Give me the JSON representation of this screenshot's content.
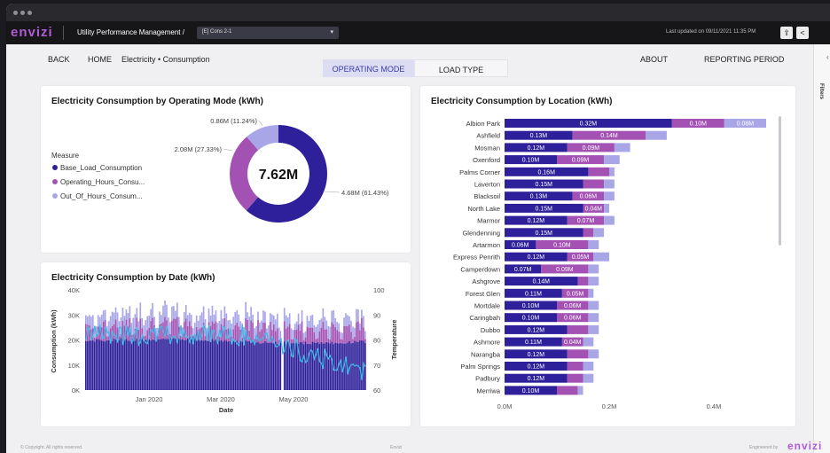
{
  "app": {
    "logo": "envizi",
    "title": "Utility Performance Management  /",
    "dropdown_value": "[E] Cons 2-1",
    "last_updated": "Last updated on 09/11/2021 11:35 PM",
    "footer_left": "© Copyright. All rights reserved.",
    "footer_center": "Envizi",
    "footer_right_label": "Engineered by",
    "footer_right_logo": "envizi"
  },
  "nav": {
    "back": "BACK",
    "home": "HOME",
    "breadcrumb": "Electricity • Consumption",
    "about": "ABOUT",
    "reporting_period": "REPORTING PERIOD",
    "filters": "Filters"
  },
  "tabs": [
    {
      "label": "OPERATING MODE",
      "active": true
    },
    {
      "label": "LOAD TYPE",
      "active": false
    }
  ],
  "colors": {
    "base": "#2e1f9a",
    "operating": "#a352b4",
    "out_of_hours": "#a9a6e8",
    "temperature": "#3fb8e6",
    "accent": "#b05bd6"
  },
  "donut": {
    "title": "Electricity Consumption by Operating Mode (kWh)",
    "center_value": "7.62M",
    "legend_title": "Measure",
    "segments": [
      {
        "name": "Base_Load_Consumption",
        "legend": "Base_Load_Consumption",
        "value": 4.68,
        "label": "4.68M (61.43%)",
        "color": "#2e1f9a"
      },
      {
        "name": "Operating_Hours_Consumption",
        "legend": "Operating_Hours_Consu...",
        "value": 2.08,
        "label": "2.08M (27.33%)",
        "color": "#a352b4"
      },
      {
        "name": "Out_Of_Hours_Consumption",
        "legend": "Out_Of_Hours_Consum...",
        "value": 0.86,
        "label": "0.86M (11.24%)",
        "color": "#a9a6e8"
      }
    ]
  },
  "chart_data": [
    {
      "type": "bar",
      "orientation": "horizontal",
      "stacked": true,
      "title": "Electricity Consumption by Location (kWh)",
      "categories": [
        "Albion Park",
        "Ashfield",
        "Mosman",
        "Oxenford",
        "Palms Corner",
        "Laverton",
        "Blacksoil",
        "North Lake",
        "Marmor",
        "Glendenning",
        "Artarmon",
        "Express Penrith",
        "Camperdown",
        "Ashgrove",
        "Forest Glen",
        "Mortdale",
        "Caringbah",
        "Dubbo",
        "Ashmore",
        "Narangba",
        "Palm Springs",
        "Padbury",
        "Merriwa"
      ],
      "series": [
        {
          "name": "Base_Load_Consumption",
          "color": "#2e1f9a",
          "values": [
            0.32,
            0.13,
            0.12,
            0.1,
            0.16,
            0.15,
            0.13,
            0.15,
            0.12,
            0.15,
            0.06,
            0.12,
            0.07,
            0.14,
            0.11,
            0.1,
            0.1,
            0.12,
            0.11,
            0.12,
            0.12,
            0.12,
            0.1
          ],
          "labels": [
            "0.32M",
            "0.13M",
            "0.12M",
            "0.10M",
            "0.16M",
            "0.15M",
            "0.13M",
            "0.15M",
            "0.12M",
            "0.15M",
            "0.06M",
            "0.12M",
            "0.07M",
            "0.14M",
            "0.11M",
            "0.10M",
            "0.10M",
            "0.12M",
            "0.11M",
            "0.12M",
            "0.12M",
            "0.12M",
            "0.10M"
          ]
        },
        {
          "name": "Operating_Hours_Consumption",
          "color": "#a352b4",
          "values": [
            0.1,
            0.14,
            0.09,
            0.09,
            0.04,
            0.04,
            0.06,
            0.04,
            0.07,
            0.02,
            0.1,
            0.05,
            0.09,
            0.02,
            0.05,
            0.06,
            0.06,
            0.04,
            0.04,
            0.04,
            0.03,
            0.03,
            0.04
          ],
          "labels": [
            "0.10M",
            "0.14M",
            "0.09M",
            "0.09M",
            "",
            "",
            "0.06M",
            "0.04M",
            "0.07M",
            "",
            "0.10M",
            "0.05M",
            "0.09M",
            "",
            "0.05M",
            "0.06M",
            "0.06M",
            "",
            "0.04M",
            "",
            "",
            "",
            ""
          ]
        },
        {
          "name": "Out_Of_Hours_Consumption",
          "color": "#a9a6e8",
          "values": [
            0.08,
            0.04,
            0.03,
            0.03,
            0.01,
            0.02,
            0.02,
            0.01,
            0.02,
            0.02,
            0.02,
            0.03,
            0.02,
            0.02,
            0.01,
            0.02,
            0.02,
            0.02,
            0.02,
            0.02,
            0.02,
            0.02,
            0.01
          ],
          "labels": [
            "0.08M",
            "",
            "",
            "",
            "",
            "",
            "",
            "",
            "",
            "",
            "",
            "",
            "",
            "",
            "",
            "",
            "",
            "",
            "",
            "",
            "",
            "",
            ""
          ]
        }
      ],
      "xticks": [
        "0.0M",
        "0.2M",
        "0.4M"
      ],
      "xlim": [
        0,
        0.5
      ]
    },
    {
      "type": "bar",
      "stacked": true,
      "title": "Electricity Consumption by Date (kWh)",
      "xlabel": "Date",
      "ylabel": "Consumption (kWh)",
      "y2label": "Temperature",
      "ylim": [
        0,
        40000
      ],
      "y2lim": [
        60,
        100
      ],
      "yticks": [
        "0K",
        "10K",
        "20K",
        "30K",
        "40K"
      ],
      "y2ticks": [
        "60",
        "70",
        "80",
        "90",
        "100"
      ],
      "xticks": [
        "Jan 2020",
        "Mar 2020",
        "May 2020"
      ],
      "xrange": [
        "2019-11-01",
        "2020-07-18"
      ],
      "daily_ranges": {
        "base_load": [
          17000,
          21000
        ],
        "operating_hours": [
          4000,
          9000
        ],
        "out_of_hours": [
          3000,
          7000
        ],
        "temperature": [
          64,
          88
        ]
      }
    }
  ]
}
